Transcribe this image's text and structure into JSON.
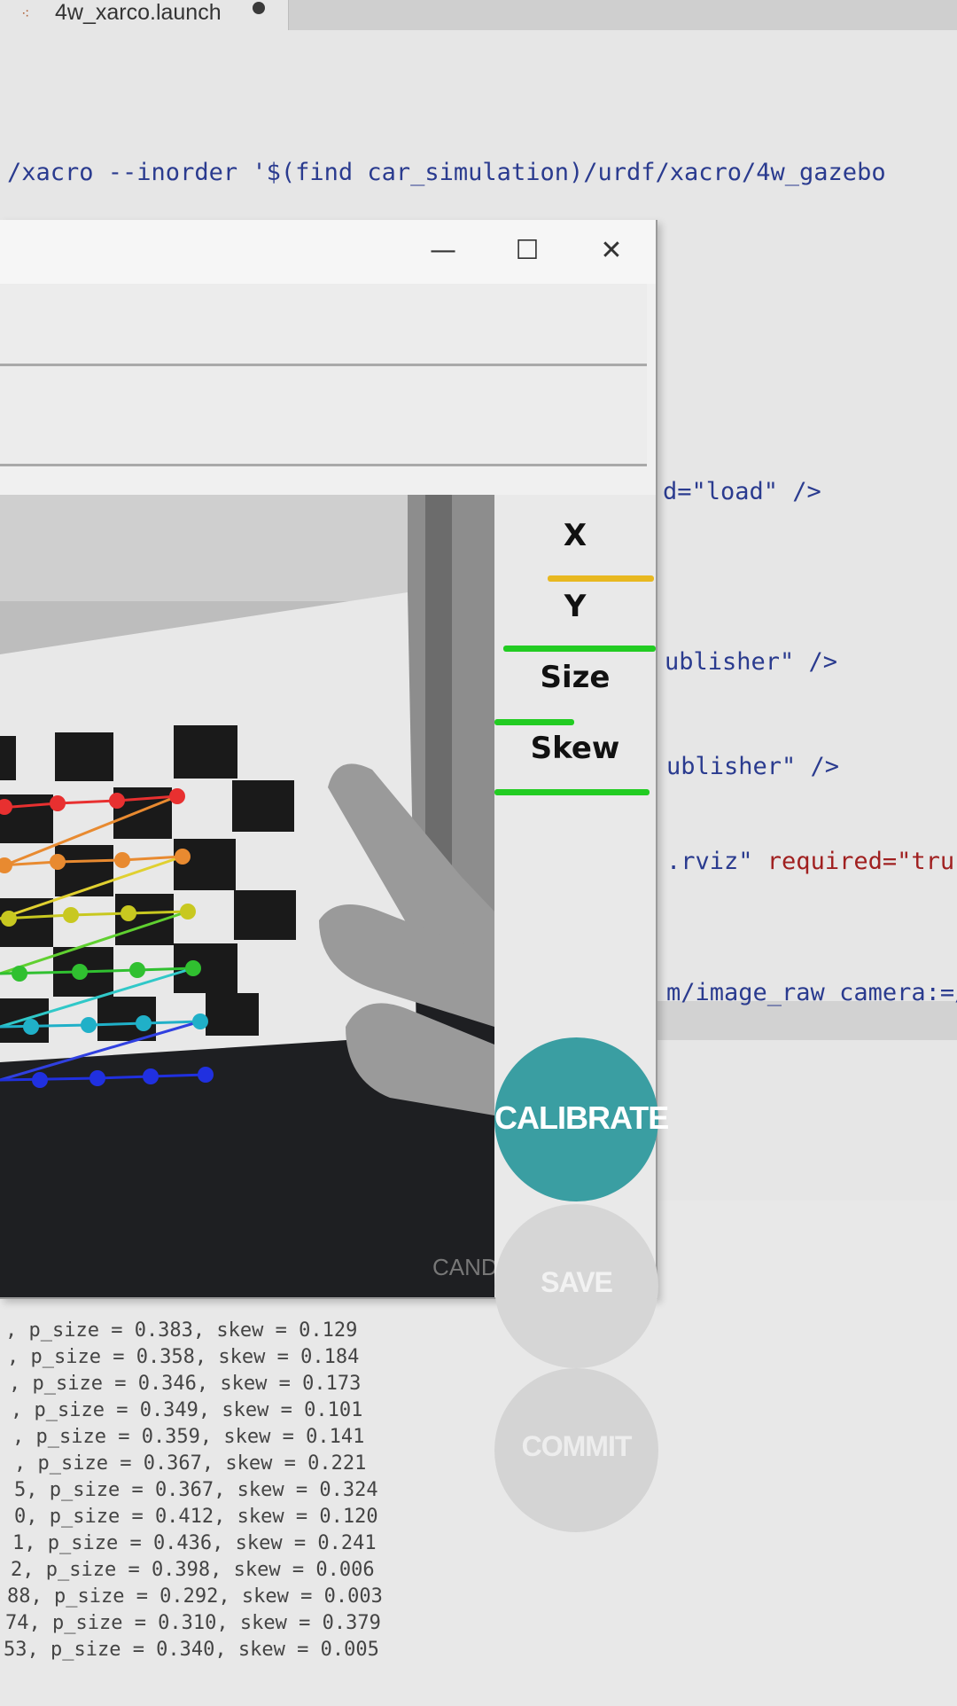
{
  "tab": {
    "title": "4w_xarco.launch"
  },
  "code_lines": {
    "xacro": "/xacro --inorder '$(find car_simulation)/urdf/xacro/4w_gazebo",
    "load": "d=\"load\" />",
    "publisher1": "ublisher\" />",
    "publisher2": "ublisher\" />",
    "rviz_a": ".rviz\" ",
    "rviz_b": "required=\"tru",
    "image_raw": "m/image_raw camera:=/"
  },
  "window": {
    "minimize": "—",
    "maximize": "☐",
    "close": "✕"
  },
  "sidebar": {
    "metrics": [
      {
        "label": "X",
        "progress": 0.55,
        "color": "#e8b820"
      },
      {
        "label": "Y",
        "progress": 0.75,
        "color": "#22cc22"
      },
      {
        "label": "Size",
        "progress": 0.4,
        "color": "#22cc22"
      },
      {
        "label": "Skew",
        "progress": 0.8,
        "color": "#22cc22"
      }
    ],
    "buttons": {
      "calibrate": "CALIBRATE",
      "save": "SAVE",
      "commit": "COMMIT"
    },
    "colors": {
      "calibrate": "#3a9ea2",
      "disabled": "#d6d6d6"
    }
  },
  "camera": {
    "overlay_text": "CAND"
  },
  "terminal": [
    ", p_size = 0.383, skew = 0.129",
    ", p_size = 0.358, skew = 0.184",
    ", p_size = 0.346, skew = 0.173",
    ", p_size = 0.349, skew = 0.101",
    ", p_size = 0.359, skew = 0.141",
    ", p_size = 0.367, skew = 0.221",
    "5, p_size = 0.367, skew = 0.324",
    "0, p_size = 0.412, skew = 0.120",
    "1, p_size = 0.436, skew = 0.241",
    "2, p_size = 0.398, skew = 0.006",
    "88, p_size = 0.292, skew = 0.003",
    "74, p_size = 0.310, skew = 0.379",
    "53, p_size = 0.340, skew = 0.005"
  ]
}
